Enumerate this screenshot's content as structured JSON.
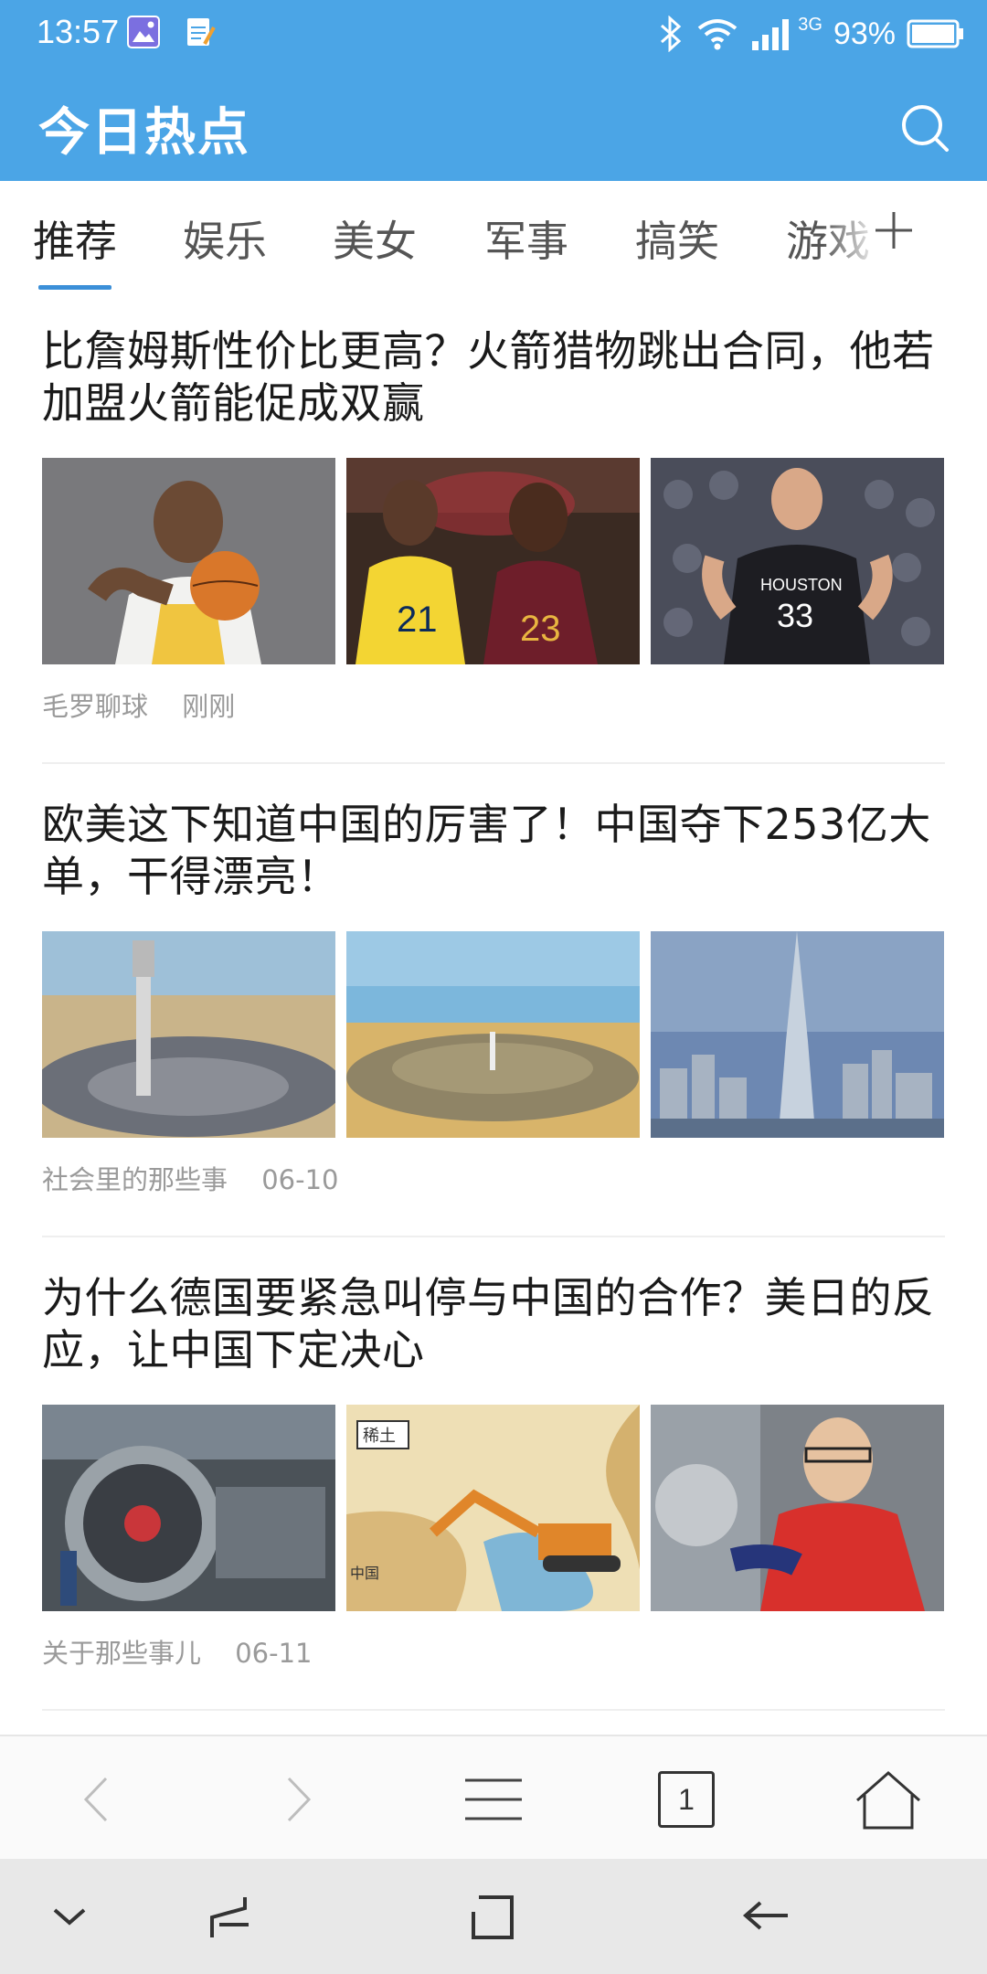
{
  "status_bar": {
    "time": "13:57",
    "network": "3G",
    "battery": "93%"
  },
  "header": {
    "title": "今日热点"
  },
  "tabs": [
    {
      "label": "推荐",
      "active": true
    },
    {
      "label": "娱乐",
      "active": false
    },
    {
      "label": "美女",
      "active": false
    },
    {
      "label": "军事",
      "active": false
    },
    {
      "label": "搞笑",
      "active": false
    },
    {
      "label": "游戏",
      "active": false
    }
  ],
  "articles": [
    {
      "title": "比詹姆斯性价比更高？火箭猎物跳出合同，他若加盟火箭能促成双赢",
      "source": "毛罗聊球",
      "time": "刚刚",
      "images": [
        "basketball-player-pacers-photo",
        "pacers-vs-cavaliers-photo",
        "rockets-player-photo"
      ]
    },
    {
      "title": "欧美这下知道中国的厉害了！中国夺下253亿大单，干得漂亮！",
      "source": "社会里的那些事",
      "time": "06-10",
      "images": [
        "solar-tower-plant-photo",
        "solar-field-aerial-photo",
        "skyscraper-city-photo"
      ]
    },
    {
      "title": "为什么德国要紧急叫停与中国的合作？美日的反应，让中国下定决心",
      "source": "关于那些事儿",
      "time": "06-11",
      "images": [
        "jet-engine-factory-photo",
        "rare-earth-cartoon",
        "engineer-worker-photo"
      ]
    }
  ],
  "toolbar": {
    "tab_count": "1"
  },
  "colors": {
    "brand_blue": "#4ba5e6",
    "tab_indicator": "#3b8fd8"
  }
}
